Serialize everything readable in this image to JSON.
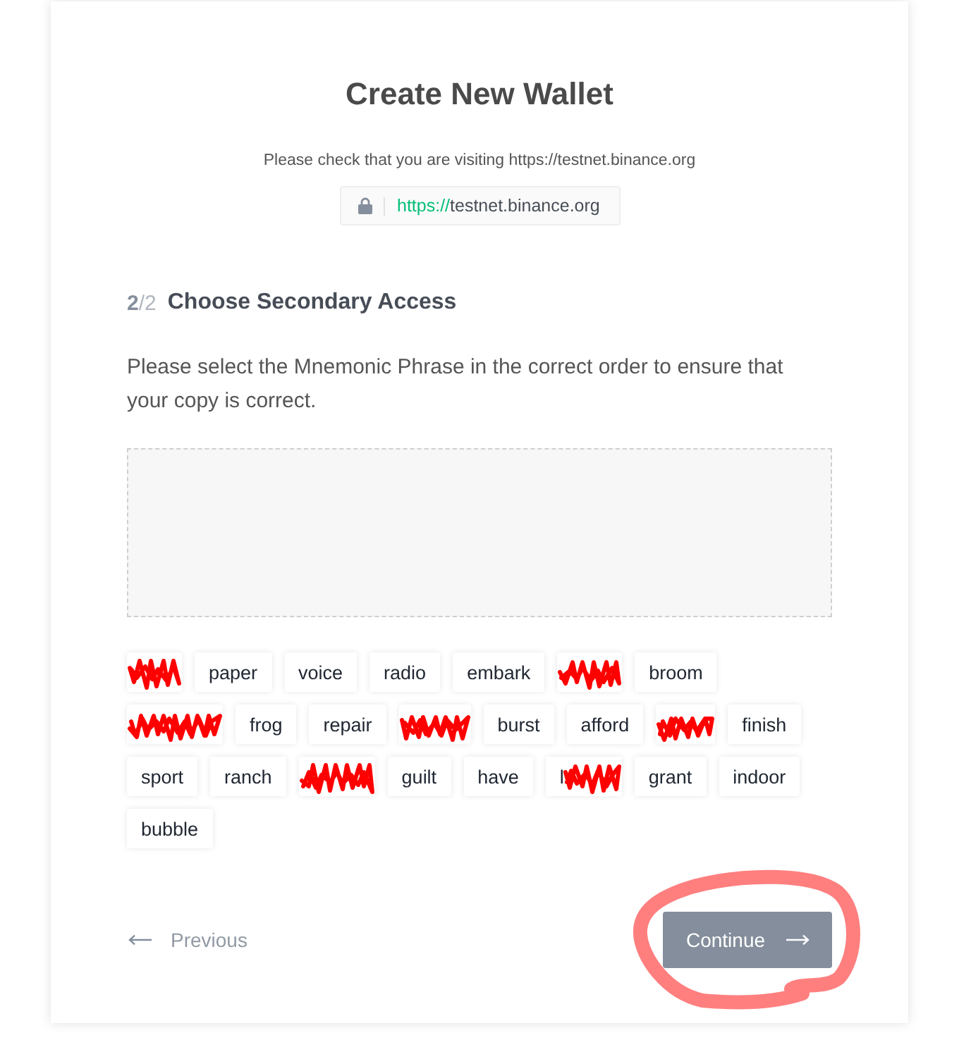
{
  "title": "Create New Wallet",
  "notice": "Please check that you are visiting https://testnet.binance.org",
  "url_bar": {
    "scheme": "https://",
    "host": "testnet.binance.org"
  },
  "step": {
    "current": "2",
    "total": "/2",
    "title": "Choose Secondary Access"
  },
  "instructions": "Please select the Mnemonic Phrase in the correct order to ensure that your copy is correct.",
  "words": [
    {
      "kind": "scribbled"
    },
    {
      "kind": "word",
      "text": "paper"
    },
    {
      "kind": "word",
      "text": "voice"
    },
    {
      "kind": "word",
      "text": "radio"
    },
    {
      "kind": "word",
      "text": "embark"
    },
    {
      "kind": "scribbled"
    },
    {
      "kind": "word",
      "text": "broom"
    },
    {
      "kind": "scribbled"
    },
    {
      "kind": "word",
      "text": "frog"
    },
    {
      "kind": "word",
      "text": "repair"
    },
    {
      "kind": "scribbled"
    },
    {
      "kind": "word",
      "text": "burst"
    },
    {
      "kind": "word",
      "text": "afford"
    },
    {
      "kind": "scribbled"
    },
    {
      "kind": "word",
      "text": "finish"
    },
    {
      "kind": "word",
      "text": "sport"
    },
    {
      "kind": "word",
      "text": "ranch"
    },
    {
      "kind": "scribbled"
    },
    {
      "kind": "word",
      "text": "guilt"
    },
    {
      "kind": "word",
      "text": "have"
    },
    {
      "kind": "scribbled",
      "text": "l"
    },
    {
      "kind": "word",
      "text": "grant"
    },
    {
      "kind": "word",
      "text": "indoor"
    },
    {
      "kind": "word",
      "text": "bubble"
    }
  ],
  "footer": {
    "previous": "Previous",
    "continue": {
      "label": "Continue",
      "disabled": true,
      "circled": true
    }
  }
}
